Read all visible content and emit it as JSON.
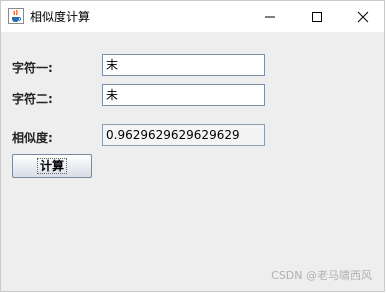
{
  "window": {
    "title": "相似度计算",
    "icon": "java-cup-icon",
    "controls": {
      "minimize": "minimize-icon",
      "maximize": "maximize-icon",
      "close": "close-icon"
    }
  },
  "form": {
    "string1_label": "字符一:",
    "string1_value": "末",
    "string2_label": "字符二:",
    "string2_value": "未",
    "similarity_label": "相似度:",
    "similarity_value": "0.9629629629629629",
    "calculate_label": "计算"
  },
  "watermark": "CSDN @老马啸西风",
  "colors": {
    "window_bg": "#eeeeee",
    "titlebar_bg": "#ffffff",
    "field_border": "#7a8fa6"
  }
}
